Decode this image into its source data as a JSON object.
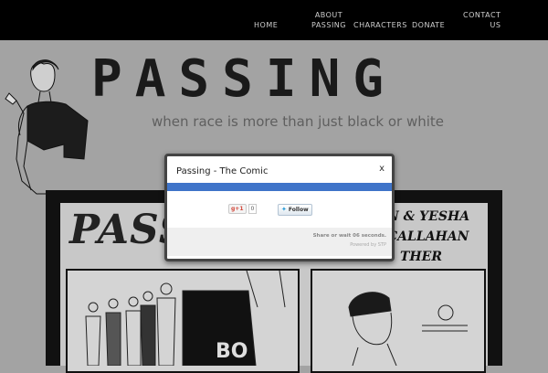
{
  "nav": {
    "home": "HOME",
    "about_line1": "ABOUT",
    "about_line2": "PASSING",
    "characters": "CHARACTERS",
    "donate": "DONATE",
    "contact_line1": "CONTACT",
    "contact_line2": "US"
  },
  "hero": {
    "title": "PASSING",
    "tagline": "when race is more than just black or white"
  },
  "comic": {
    "title_fragment": "PASS",
    "credit_line1": "N & YESHA CALLAHAN",
    "credit_line2": "THER",
    "sign_text": "BO"
  },
  "dialog": {
    "title": "Passing - The Comic",
    "close": "x",
    "gplus_label": "g+1",
    "gplus_count": "0",
    "twitter_label": "Follow",
    "share_wait": "Share or wait 06 seconds.",
    "powered_by": "Powered by STP"
  },
  "colors": {
    "nav_bg": "#000000",
    "page_bg": "#a3a3a3",
    "dialog_bar": "#3f74c9"
  }
}
